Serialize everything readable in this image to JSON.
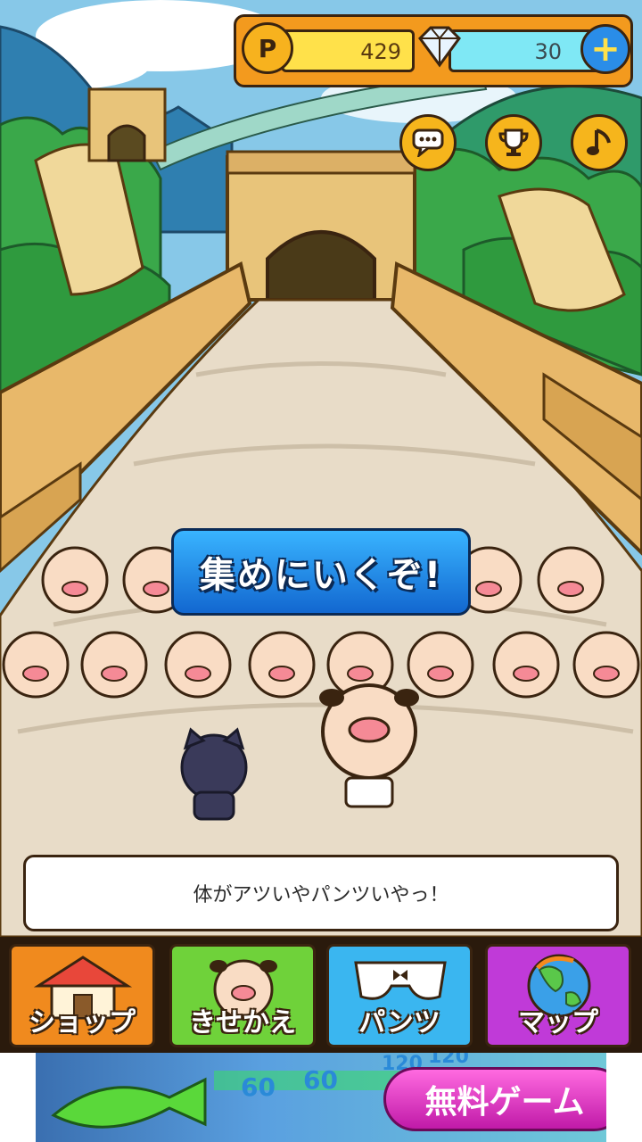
{
  "currency": {
    "coin_symbol": "P",
    "coins": "429",
    "gems": "30",
    "plus_symbol": "+"
  },
  "actions": {
    "go_button_label": "集めにいくぞ!"
  },
  "dialogue": {
    "text": "体がアツいやパンツいやっ！"
  },
  "menu": {
    "items": [
      {
        "label": "ショップ",
        "color": "#f08a1e"
      },
      {
        "label": "きせかえ",
        "color": "#6fd23a"
      },
      {
        "label": "パンツ",
        "color": "#3ab6f0"
      },
      {
        "label": "マップ",
        "color": "#c03ad8"
      }
    ]
  },
  "ad": {
    "button_label": "無料ゲーム",
    "numbers": [
      "60",
      "60",
      "120",
      "120"
    ]
  },
  "colors": {
    "sky": "#87c8e8",
    "wall": "#e8c47a",
    "path": "#e8dcc8",
    "forest": "#3aa84a",
    "bar": "#f39a1e"
  },
  "icons": [
    "coin-icon",
    "diamond-icon",
    "plus-icon",
    "chat-icon",
    "trophy-icon",
    "music-note-icon"
  ]
}
